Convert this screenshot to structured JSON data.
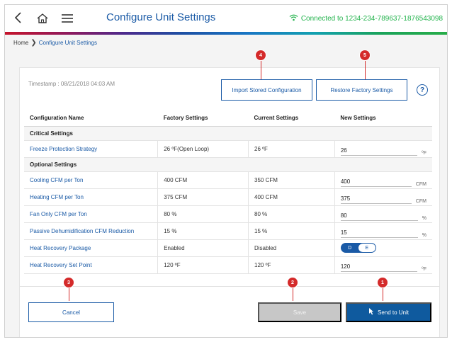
{
  "header": {
    "title": "Configure Unit Settings",
    "connection": "Connected to 1234-234-789637-1876543098",
    "icons": [
      "back-arrow-icon",
      "home-icon",
      "hamburger-menu-icon",
      "wifi-icon"
    ]
  },
  "breadcrumb": {
    "home": "Home",
    "current": "Configure Unit Settings"
  },
  "panel": {
    "timestamp": "Timestamp : 08/21/2018 04:03 AM",
    "import_label": "Import Stored Configuration",
    "restore_label": "Restore Factory Settings",
    "help_label": "?"
  },
  "table": {
    "columns": [
      "Configuration Name",
      "Factory Settings",
      "Current Settings",
      "New Settings"
    ],
    "sections": [
      {
        "title": "Critical Settings",
        "rows": [
          {
            "name": "Freeze Protection Strategy",
            "factory": "26 ºF(Open Loop)",
            "current": "26 ºF",
            "new_value": "26",
            "unit": "ºF"
          }
        ]
      },
      {
        "title": "Optional Settings",
        "rows": [
          {
            "name": "Cooling CFM per Ton",
            "factory": "400 CFM",
            "current": "350 CFM",
            "new_value": "400",
            "unit": "CFM"
          },
          {
            "name": "Heating CFM per Ton",
            "factory": "375 CFM",
            "current": "400 CFM",
            "new_value": "375",
            "unit": "CFM"
          },
          {
            "name": "Fan Only CFM per Ton",
            "factory": "80 %",
            "current": "80 %",
            "new_value": "80",
            "unit": "%"
          },
          {
            "name": "Passive Dehumidification CFM Reduction",
            "factory": "15 %",
            "current": "15 %",
            "new_value": "15",
            "unit": "%"
          },
          {
            "name": "Heat Recovery Package",
            "factory": "Enabled",
            "current": "Disabled",
            "toggle": {
              "off": "D",
              "on": "E",
              "selected": "E"
            }
          },
          {
            "name": "Heat Recovery Set Point",
            "factory": "120 ºF",
            "current": "120 ºF",
            "new_value": "120",
            "unit": "ºF"
          }
        ]
      }
    ]
  },
  "footer": {
    "cancel_label": "Cancel",
    "save_label": "Save",
    "send_label": "Send to Unit"
  },
  "markers": {
    "send": "1",
    "save": "2",
    "cancel": "3",
    "import": "4",
    "restore": "5"
  },
  "colors": {
    "primary": "#1a5aa6",
    "send_button": "#0f5a9e",
    "connected": "#22b34c",
    "marker": "#d42a2a",
    "disabled": "#c7c7c7"
  }
}
